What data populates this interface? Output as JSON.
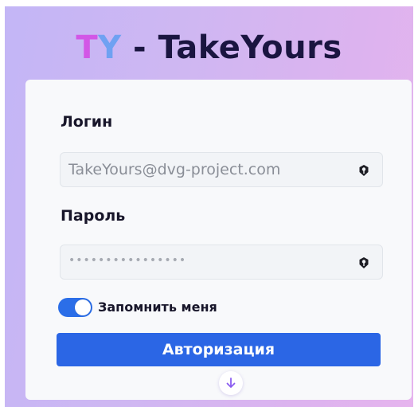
{
  "header": {
    "logo_t": "T",
    "logo_y": "Y",
    "title_rest": " - TakeYours"
  },
  "form": {
    "login_label": "Логин",
    "login_value": "TakeYours@dvg-project.com",
    "password_label": "Пароль",
    "password_mask": "••••••••••••••••",
    "remember_label": "Запомнить меня",
    "remember_checked": true,
    "submit_label": "Авторизация"
  },
  "icons": {
    "login_field_icon": "key-icon",
    "password_field_icon": "key-icon",
    "scroll_icon": "arrow-down-icon"
  },
  "colors": {
    "brand_t": "#d257e6",
    "brand_y": "#6fa1f2",
    "primary": "#2b66e5"
  }
}
